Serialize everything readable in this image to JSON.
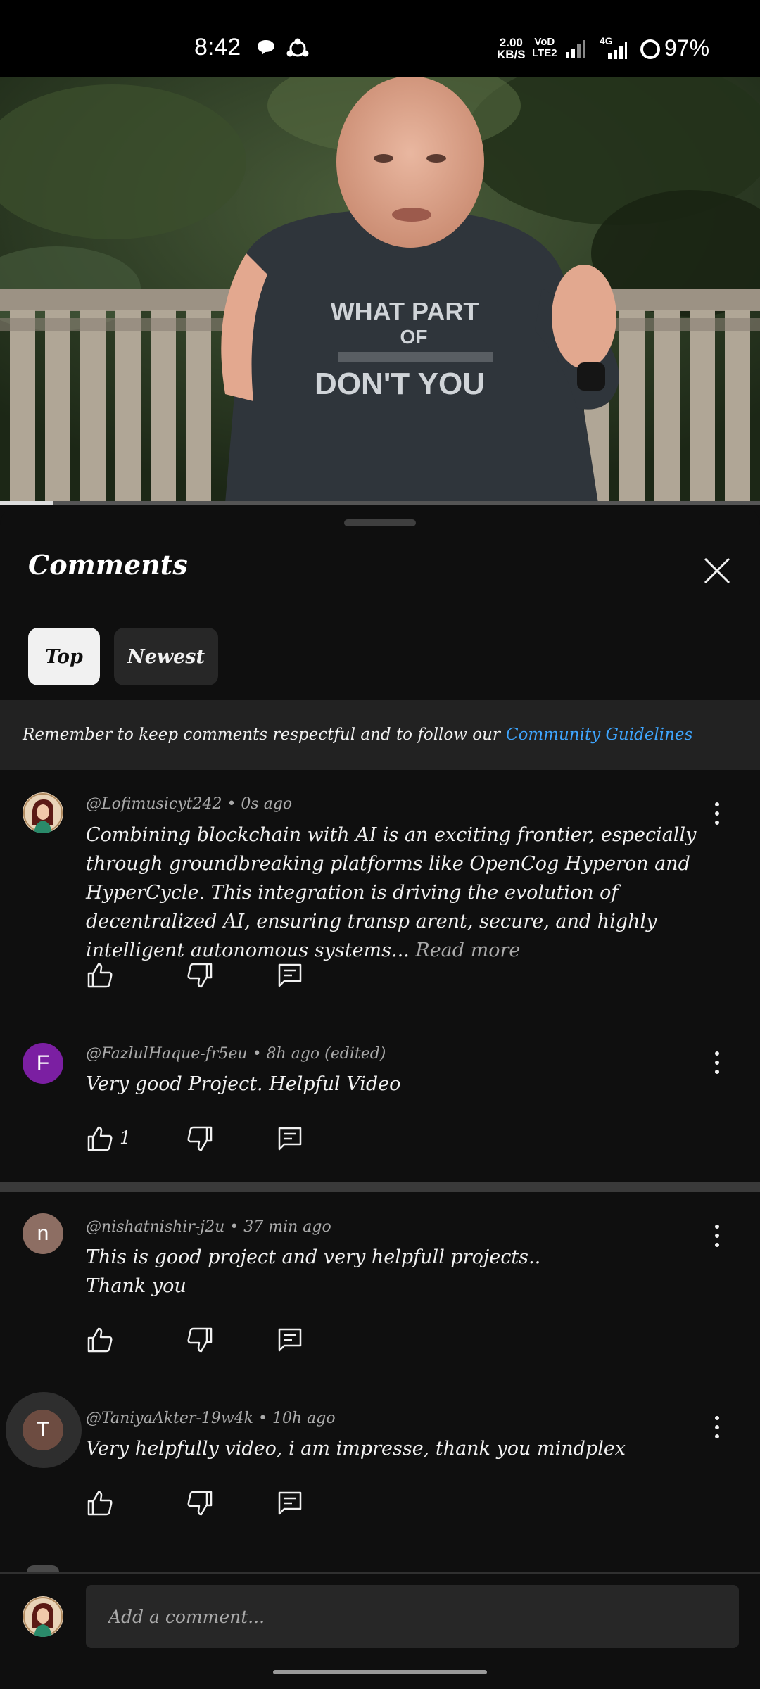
{
  "status_bar": {
    "time": "8:42",
    "net_speed_value": "2.00",
    "net_speed_unit": "KB/S",
    "volte_top": "VoD",
    "volte_bottom": "LTE2",
    "network": "4G",
    "battery": "97%"
  },
  "video": {
    "shirt_line1": "WHAT PART",
    "shirt_line2": "OF",
    "shirt_line3": "DON'T YOU",
    "playback_progress_fraction": 0.07
  },
  "comments_sheet": {
    "title": "Comments",
    "filters": [
      {
        "label": "Top",
        "selected": true
      },
      {
        "label": "Newest",
        "selected": false
      }
    ],
    "guidelines_text": "Remember to keep comments respectful and to follow our",
    "guidelines_link": "Community Guidelines",
    "comments": [
      {
        "meta": "@Lofimusicyt242 • 0s ago",
        "text": "Combining blockchain with AI is an exciting frontier, especially through groundbreaking platforms like OpenCog Hyperon and HyperCycle. This integration is driving the evolution of decentralized AI, ensuring transp arent, secure, and highly intelligent autonomous systems...",
        "read_more": "Read more",
        "avatar": "profile-photo"
      },
      {
        "meta": "@FazlulHaque-fr5eu • 8h ago (edited)",
        "text": "Very good Project. Helpful Video",
        "avatar_letter": "F",
        "avatar_color": "#7b1fa2",
        "likes": "1"
      },
      {
        "meta": "@nishatnishir-j2u • 37 min ago",
        "text_line1": "This is good project and very helpfull projects..",
        "text_line2": "Thank you",
        "avatar_letter": "n",
        "avatar_color": "#8d6e63"
      },
      {
        "meta": "@TaniyaAkter-19w4k • 10h ago",
        "text": "Very helpfully video, i am impresse, thank you mindplex",
        "avatar_letter": "T",
        "avatar_color": "#6d4c41"
      }
    ],
    "composer_placeholder": "Add a comment..."
  },
  "colors": {
    "background": "#0f0f0f",
    "chip_selected": "#f1f1f1",
    "chip_unselected": "#272727",
    "link": "#3ea6ff",
    "secondary_text": "#aaaaaa"
  },
  "icons": [
    "chat-bubble-icon",
    "share-hub-icon",
    "signal-icon",
    "battery-ring-icon",
    "close-icon",
    "thumbs-up-icon",
    "thumbs-down-icon",
    "reply-icon",
    "more-vert-icon"
  ]
}
